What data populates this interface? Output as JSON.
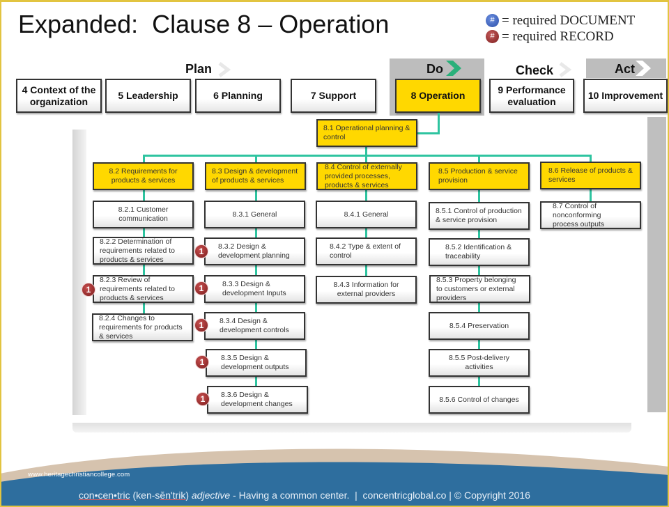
{
  "title": "Expanded:  Clause 8 – Operation",
  "legend": {
    "document": {
      "symbol": "#",
      "label": "= required DOCUMENT",
      "color": "#3a5fbf"
    },
    "record": {
      "symbol": "#",
      "label": "= required RECORD",
      "color": "#9a2a2a"
    }
  },
  "pdca": {
    "plan": "Plan",
    "do": "Do",
    "check": "Check",
    "act": "Act"
  },
  "clauses": [
    {
      "label": "4 Context of the organization",
      "active": false
    },
    {
      "label": "5 Leadership",
      "active": false
    },
    {
      "label": "6 Planning",
      "active": false
    },
    {
      "label": "7 Support",
      "active": false
    },
    {
      "label": "8 Operation",
      "active": true
    },
    {
      "label": "9 Performance evaluation",
      "active": false
    },
    {
      "label": "10 Improvement",
      "active": false
    }
  ],
  "root": "8.1 Operational planning & control",
  "columns": [
    {
      "header": "8.2 Requirements  for products & services",
      "items": [
        {
          "label": "8.2.1 Customer communication",
          "record": null
        },
        {
          "label": "8.2.2 Determination of requirements related to products & services",
          "record": null
        },
        {
          "label": "8.2.3 Review of requirements related to products & services",
          "record": "1"
        },
        {
          "label": "8.2.4 Changes to requirements for products & services",
          "record": null
        }
      ]
    },
    {
      "header": "8.3 Design & development of products & services",
      "items": [
        {
          "label": "8.3.1 General",
          "record": null
        },
        {
          "label": "8.3.2 Design & development  planning",
          "record": "1"
        },
        {
          "label": "8.3.3 Design & development  Inputs",
          "record": "1"
        },
        {
          "label": "8.3.4 Design & development  controls",
          "record": "1"
        },
        {
          "label": "8.3.5 Design & development  outputs",
          "record": "1"
        },
        {
          "label": "8.3.6 Design & development  changes",
          "record": "1"
        }
      ]
    },
    {
      "header": "8.4 Control of externally provided processes, products & services",
      "items": [
        {
          "label": "8.4.1 General",
          "record": null
        },
        {
          "label": "8.4.2 Type & extent  of control",
          "record": null
        },
        {
          "label": "8.4.3 Information  for external  providers",
          "record": null
        }
      ]
    },
    {
      "header": "8.5 Production & service provision",
      "items": [
        {
          "label": "8.5.1 Control of production & service provision",
          "record": null
        },
        {
          "label": "8.5.2 Identification & traceability",
          "record": null
        },
        {
          "label": "8.5.3 Property belonging  to customers or external providers",
          "record": null
        },
        {
          "label": "8.5.4 Preservation",
          "record": null
        },
        {
          "label": "8.5.5 Post-delivery  activities",
          "record": null
        },
        {
          "label": "8.5.6 Control of changes",
          "record": null
        }
      ]
    },
    {
      "header": "8.6 Release  of products & services",
      "items": [
        {
          "label": "8.7 Control of nonconforming process outputs",
          "record": null
        }
      ]
    }
  ],
  "footer": {
    "watermark": "www.heritagechristiancollege.com",
    "word": "con•cen•tric",
    "pronunciation_pre": " (ken-s",
    "pronunciation_ul": "ĕn'trik",
    "pronunciation_post": ") ",
    "pos": "adjective",
    "rest": " - Having a common center.  |  concentricglobal.co | © Copyright 2016"
  },
  "colors": {
    "accent_yellow": "#ffd800",
    "connector": "#2ec4a0",
    "footer_blue": "#2e6e9e",
    "footer_tan": "#d6c3ae",
    "frame": "#e2c440"
  }
}
